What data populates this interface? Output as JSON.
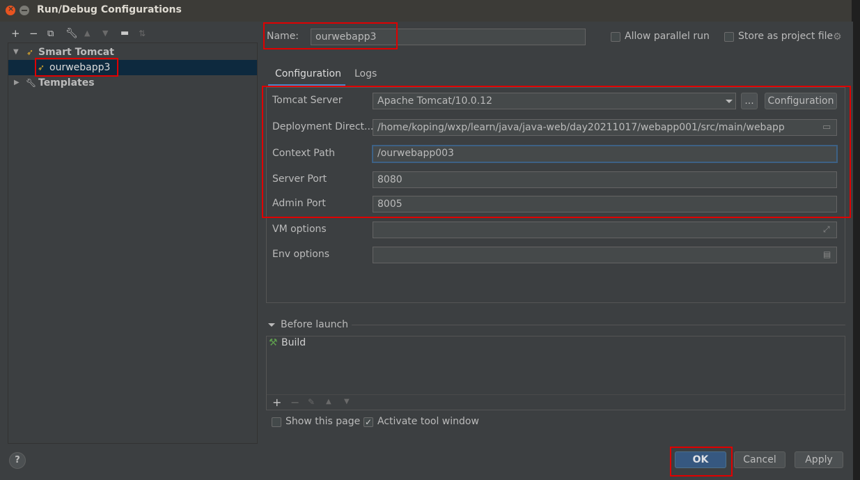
{
  "window": {
    "title": "Run/Debug Configurations",
    "close_color": "#e95420",
    "min_color": "#7b7a74"
  },
  "left_toolbar": {
    "icons": [
      "add-icon",
      "remove-icon",
      "copy-icon",
      "wrench-icon",
      "move-up-icon",
      "move-down-icon",
      "folder-icon",
      "sort-icon"
    ]
  },
  "tree": {
    "group_label": "Smart Tomcat",
    "item_label": "ourwebapp3",
    "templates_label": "Templates"
  },
  "name_field": {
    "label": "Name:",
    "value": "ourwebapp3"
  },
  "options": {
    "allow_parallel": "Allow parallel run",
    "store_as_project": "Store as project file"
  },
  "tabs": [
    "Configuration",
    "Logs"
  ],
  "form": {
    "tomcat_server": {
      "label": "Tomcat Server",
      "value": "Apache Tomcat/10.0.12",
      "more_label": "...",
      "config_label": "Configuration"
    },
    "deployment": {
      "label": "Deployment Direct...",
      "value": "/home/koping/wxp/learn/java/java-web/day20211017/webapp001/src/main/webapp"
    },
    "context_path": {
      "label": "Context Path",
      "value": "/ourwebapp003"
    },
    "server_port": {
      "label": "Server Port",
      "value": "8080"
    },
    "admin_port": {
      "label": "Admin Port",
      "value": "8005"
    },
    "vm_options": {
      "label": "VM options",
      "value": ""
    },
    "env_options": {
      "label": "Env options",
      "value": ""
    }
  },
  "before_launch": {
    "title": "Before launch",
    "task": "Build",
    "show_page": "Show this page",
    "activate_tool": "Activate tool window"
  },
  "buttons": {
    "ok": "OK",
    "cancel": "Cancel",
    "apply": "Apply",
    "help": "?"
  },
  "colors": {
    "highlight": "#e00000",
    "accent": "#365880",
    "selection": "#0d293e"
  }
}
